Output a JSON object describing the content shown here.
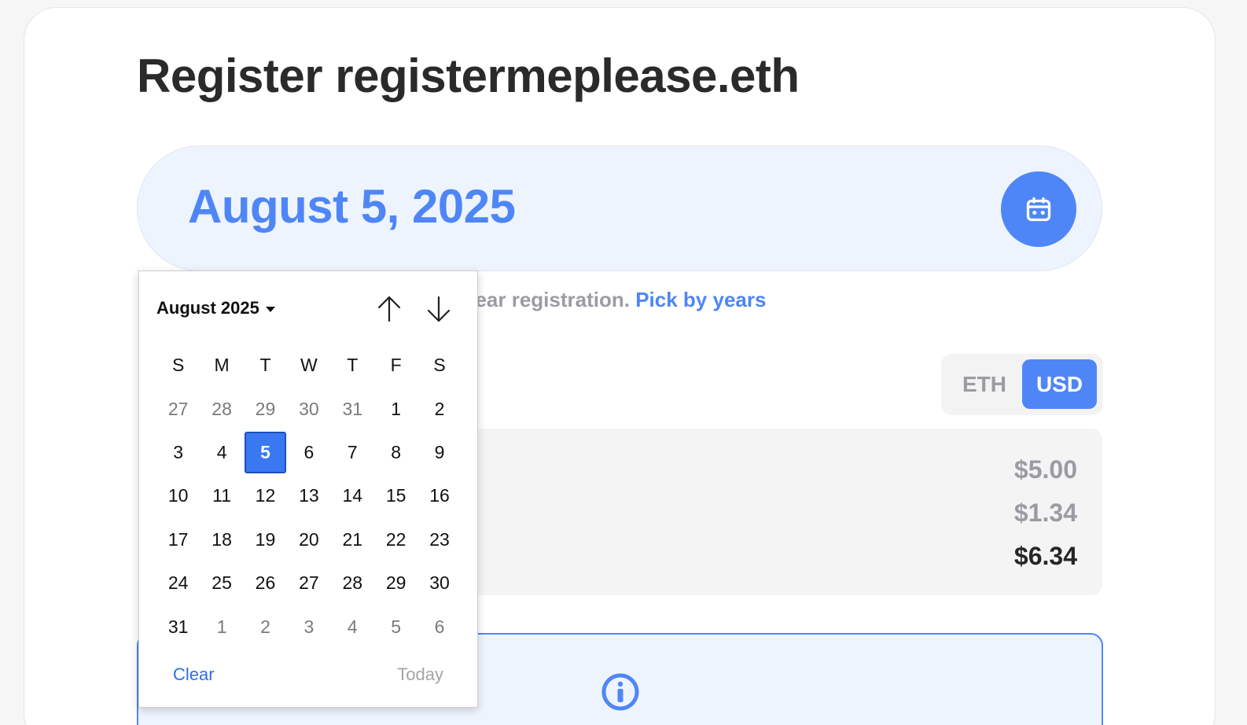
{
  "page": {
    "title": "Register registermeplease.eth",
    "selected_date": "August 5, 2025",
    "hint_text": "year registration.",
    "hint_link": "Pick by years"
  },
  "currency_toggle": {
    "options": [
      "ETH",
      "USD"
    ],
    "selected": "USD"
  },
  "prices": {
    "registration": "$5.00",
    "fee": "$1.34",
    "total": "$6.34"
  },
  "date_picker": {
    "month_label": "August 2025",
    "weekdays": [
      "S",
      "M",
      "T",
      "W",
      "T",
      "F",
      "S"
    ],
    "weeks": [
      [
        {
          "d": "27",
          "o": true
        },
        {
          "d": "28",
          "o": true
        },
        {
          "d": "29",
          "o": true
        },
        {
          "d": "30",
          "o": true
        },
        {
          "d": "31",
          "o": true
        },
        {
          "d": "1"
        },
        {
          "d": "2"
        }
      ],
      [
        {
          "d": "3"
        },
        {
          "d": "4"
        },
        {
          "d": "5",
          "sel": true
        },
        {
          "d": "6"
        },
        {
          "d": "7"
        },
        {
          "d": "8"
        },
        {
          "d": "9"
        }
      ],
      [
        {
          "d": "10"
        },
        {
          "d": "11"
        },
        {
          "d": "12"
        },
        {
          "d": "13"
        },
        {
          "d": "14"
        },
        {
          "d": "15"
        },
        {
          "d": "16"
        }
      ],
      [
        {
          "d": "17"
        },
        {
          "d": "18"
        },
        {
          "d": "19"
        },
        {
          "d": "20"
        },
        {
          "d": "21"
        },
        {
          "d": "22"
        },
        {
          "d": "23"
        }
      ],
      [
        {
          "d": "24"
        },
        {
          "d": "25"
        },
        {
          "d": "26"
        },
        {
          "d": "27"
        },
        {
          "d": "28"
        },
        {
          "d": "29"
        },
        {
          "d": "30"
        }
      ],
      [
        {
          "d": "31"
        },
        {
          "d": "1",
          "o": true
        },
        {
          "d": "2",
          "o": true
        },
        {
          "d": "3",
          "o": true
        },
        {
          "d": "4",
          "o": true
        },
        {
          "d": "5",
          "o": true
        },
        {
          "d": "6",
          "o": true
        }
      ]
    ],
    "clear_label": "Clear",
    "today_label": "Today"
  },
  "icons": {
    "calendar": "calendar-icon",
    "info": "info-icon",
    "prev": "arrow-up-icon",
    "next": "arrow-down-icon",
    "month_menu": "caret-down-icon"
  },
  "colors": {
    "accent": "#4f86f7",
    "selected_day": "#3a78f2",
    "muted_text": "#9b9ba3"
  }
}
